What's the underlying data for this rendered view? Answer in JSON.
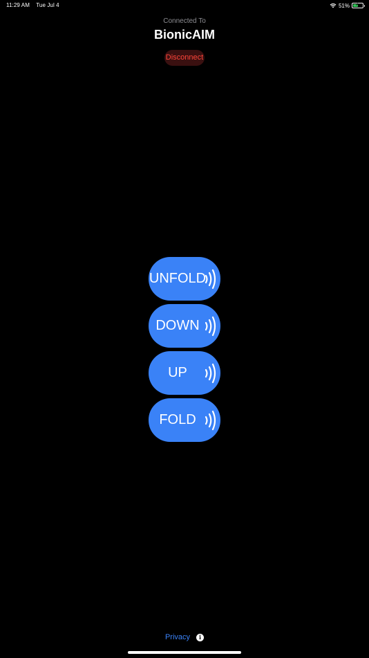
{
  "status_bar": {
    "time": "11:29 AM",
    "date": "Tue Jul 4",
    "battery_percent": "51%",
    "battery_level": 0.51,
    "icons": [
      "wifi-icon",
      "battery-icon",
      "charging-bolt-icon"
    ]
  },
  "header": {
    "connected_label": "Connected To",
    "device_name": "BionicAIM",
    "disconnect_label": "Disconnect"
  },
  "controls": [
    {
      "label": "UNFOLD",
      "icon": "nfc-signal-icon"
    },
    {
      "label": "DOWN",
      "icon": "nfc-signal-icon"
    },
    {
      "label": "UP",
      "icon": "nfc-signal-icon"
    },
    {
      "label": "FOLD",
      "icon": "nfc-signal-icon"
    }
  ],
  "footer": {
    "privacy_label": "Privacy",
    "info_icon_glyph": "i"
  },
  "colors": {
    "background": "#000000",
    "button_blue": "#3a82f7",
    "disconnect_text": "#ff453a",
    "disconnect_bg": "#3a1010",
    "battery_green": "#34c759"
  }
}
